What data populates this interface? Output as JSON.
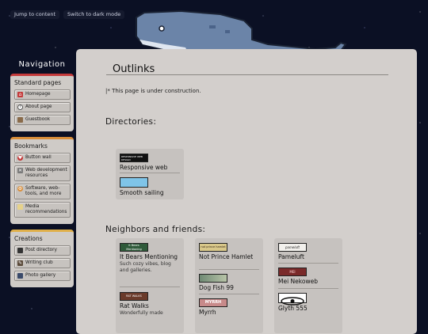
{
  "skip_links": {
    "content": "Jump to content",
    "theme": "Switch to dark mode"
  },
  "sidebar": {
    "heading": "Navigation",
    "groups": [
      {
        "title": "Standard pages",
        "items": [
          "Homepage",
          "About page",
          "Guestbook"
        ]
      },
      {
        "title": "Bookmarks",
        "items": [
          "Button wall",
          "Web development resources",
          "Software, web-tools, and more",
          "Media recommendations"
        ]
      },
      {
        "title": "Creations",
        "items": [
          "Post directory",
          "Writing club",
          "Photo gallery"
        ]
      }
    ]
  },
  "main": {
    "title": "Outlinks",
    "notice": "|* This page is under construction.",
    "directories_heading": "Directories:",
    "directories": [
      {
        "name": "Responsive web",
        "badge": "RESPONSIVE WEB DESIGN"
      },
      {
        "name": "Smooth sailing"
      }
    ],
    "neighbors_heading": "Neighbors and friends:",
    "neighbors": [
      {
        "name": "It Bears Mentioning",
        "desc": "Such cozy vibes, blog and galleries.",
        "badge": "It Bears Mentioning"
      },
      {
        "name": "Rat Walks",
        "desc": "Wonderfully made",
        "badge": "RAT WALKS"
      },
      {
        "name": "Not Prince Hamlet",
        "badge": "not prince hamlet"
      },
      {
        "name": "Dog Fish 99"
      },
      {
        "name": "Myrrh",
        "badge": "MYRRH"
      },
      {
        "name": "Pameluft",
        "badge": "pameluft"
      },
      {
        "name": "Mei Nekoweb",
        "badge": "MEI"
      },
      {
        "name": "Glyth 555"
      }
    ]
  },
  "colors": {
    "background": "#0b1024",
    "panel": "#d3cfcc",
    "whale": "#6b84a8",
    "accent_red": "#c43a3a"
  }
}
